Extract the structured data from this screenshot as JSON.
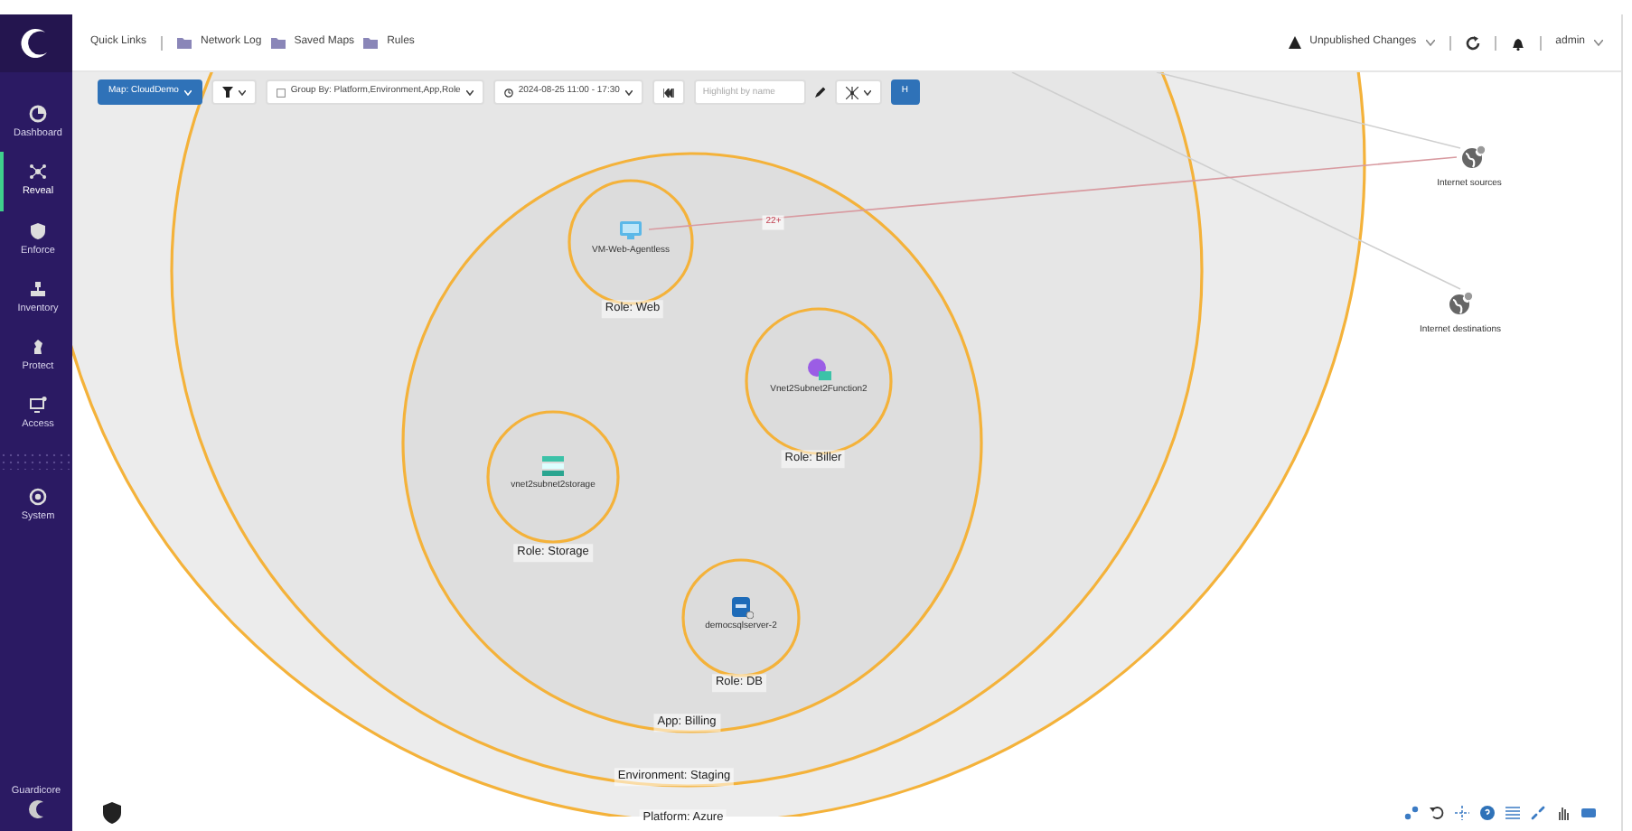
{
  "header": {
    "quick_links": "Quick Links",
    "links": [
      "Network Log",
      "Saved Maps",
      "Rules"
    ],
    "unpublished": "Unpublished Changes",
    "user": "admin"
  },
  "sidebar": {
    "items": [
      {
        "label": "Dashboard",
        "kind": "dashboard",
        "selected": false
      },
      {
        "label": "Reveal",
        "kind": "reveal",
        "selected": true
      },
      {
        "label": "Enforce",
        "kind": "enforce",
        "selected": false
      },
      {
        "label": "Inventory",
        "kind": "inventory",
        "selected": false
      },
      {
        "label": "Protect",
        "kind": "protect",
        "selected": false
      },
      {
        "label": "Access",
        "kind": "access",
        "selected": false
      },
      {
        "label": "System",
        "kind": "system",
        "selected": false
      }
    ],
    "brand": "Guardicore"
  },
  "toolbar": {
    "map_button": "Map: CloudDemo",
    "group_by": "Group By: Platform,Environment,App,Role",
    "time_range": "2024-08-25 11:00 - 17:30",
    "highlight_placeholder": "Highlight by name",
    "h_button": "H"
  },
  "map": {
    "groups": [
      {
        "label": "App: Billing"
      },
      {
        "label": "Environment: Staging"
      },
      {
        "label": "Platform: Azure"
      }
    ],
    "roles": [
      {
        "label": "Role: Web",
        "asset": "VM-Web-Agentless",
        "kind": "vm"
      },
      {
        "label": "Role: Biller",
        "asset": "Vnet2Subnet2Function2",
        "kind": "function"
      },
      {
        "label": "Role: Storage",
        "asset": "vnet2subnet2storage",
        "kind": "storage"
      },
      {
        "label": "Role: DB",
        "asset": "democsqlserver-2",
        "kind": "sql"
      }
    ],
    "external": [
      {
        "label": "Internet sources"
      },
      {
        "label": "Internet destinations"
      }
    ],
    "edges": [
      {
        "label": "22+"
      }
    ]
  }
}
